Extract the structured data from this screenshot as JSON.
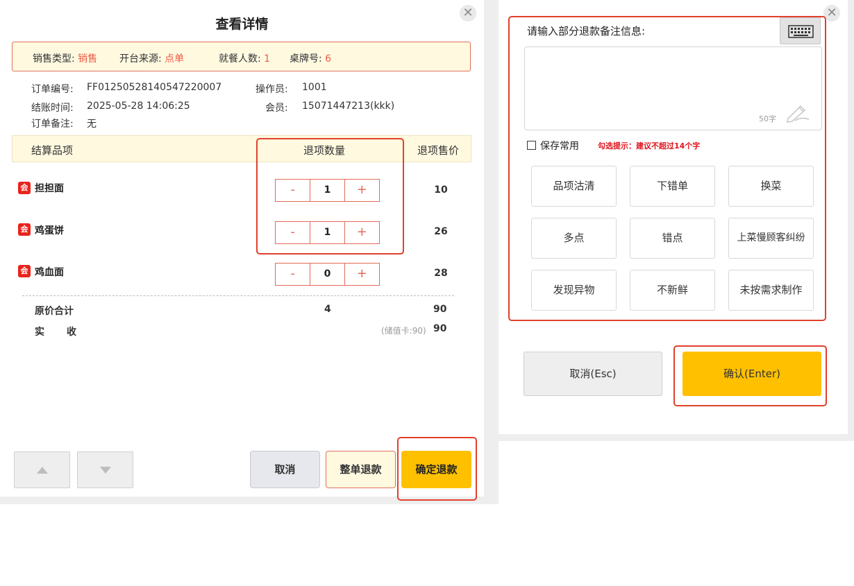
{
  "left": {
    "title": "查看详情",
    "close": "✕",
    "info": {
      "sale_type_label": "销售类型:",
      "sale_type_value": "销售",
      "source_label": "开台来源:",
      "source_value": "点单",
      "diners_label": "就餐人数:",
      "diners_value": "1",
      "table_label": "桌牌号:",
      "table_value": "6"
    },
    "order": {
      "no_label": "订单编号:",
      "no_value": "FF01250528140547220007",
      "operator_label": "操作员:",
      "operator_value": "1001",
      "time_label": "结账时间:",
      "time_value": "2025-05-28 14:06:25",
      "member_label": "会员:",
      "member_value": "15071447213(kkk)",
      "remark_label": "订单备注:",
      "remark_value": "无"
    },
    "table_header": {
      "item": "结算品项",
      "qty": "退项数量",
      "price": "退项售价"
    },
    "items": [
      {
        "badge": "会",
        "name": "担担面",
        "minus": "-",
        "qty": "1",
        "plus": "+",
        "price": "10"
      },
      {
        "badge": "会",
        "name": "鸡蛋饼",
        "minus": "-",
        "qty": "1",
        "plus": "+",
        "price": "26"
      },
      {
        "badge": "会",
        "name": "鸡血面",
        "minus": "-",
        "qty": "0",
        "plus": "+",
        "price": "28"
      }
    ],
    "summary": {
      "original_label": "原价合计",
      "original_qty": "4",
      "original_amount": "90",
      "actual_label_1": "实",
      "actual_label_2": "收",
      "actual_note": "(储值卡:90)",
      "actual_amount": "90"
    },
    "buttons": {
      "cancel": "取消",
      "full_refund": "整单退款",
      "confirm_refund": "确定退款"
    }
  },
  "right": {
    "close": "✕",
    "label": "请输入部分退款备注信息:",
    "counter": "50字",
    "save_common": "保存常用",
    "hint": "勾选提示：建议不超过14个字",
    "reasons": [
      "品项沽清",
      "下错单",
      "换菜",
      "多点",
      "错点",
      "上菜慢顾客纠纷",
      "发现异物",
      "不新鲜",
      "未按需求制作"
    ],
    "cancel": "取消(Esc)",
    "confirm": "确认(Enter)"
  },
  "colors": {
    "accent_red": "#ee5a45",
    "outline_red": "#e0402b",
    "primary_yellow": "#ffc000",
    "info_bg": "#fff9e0"
  }
}
